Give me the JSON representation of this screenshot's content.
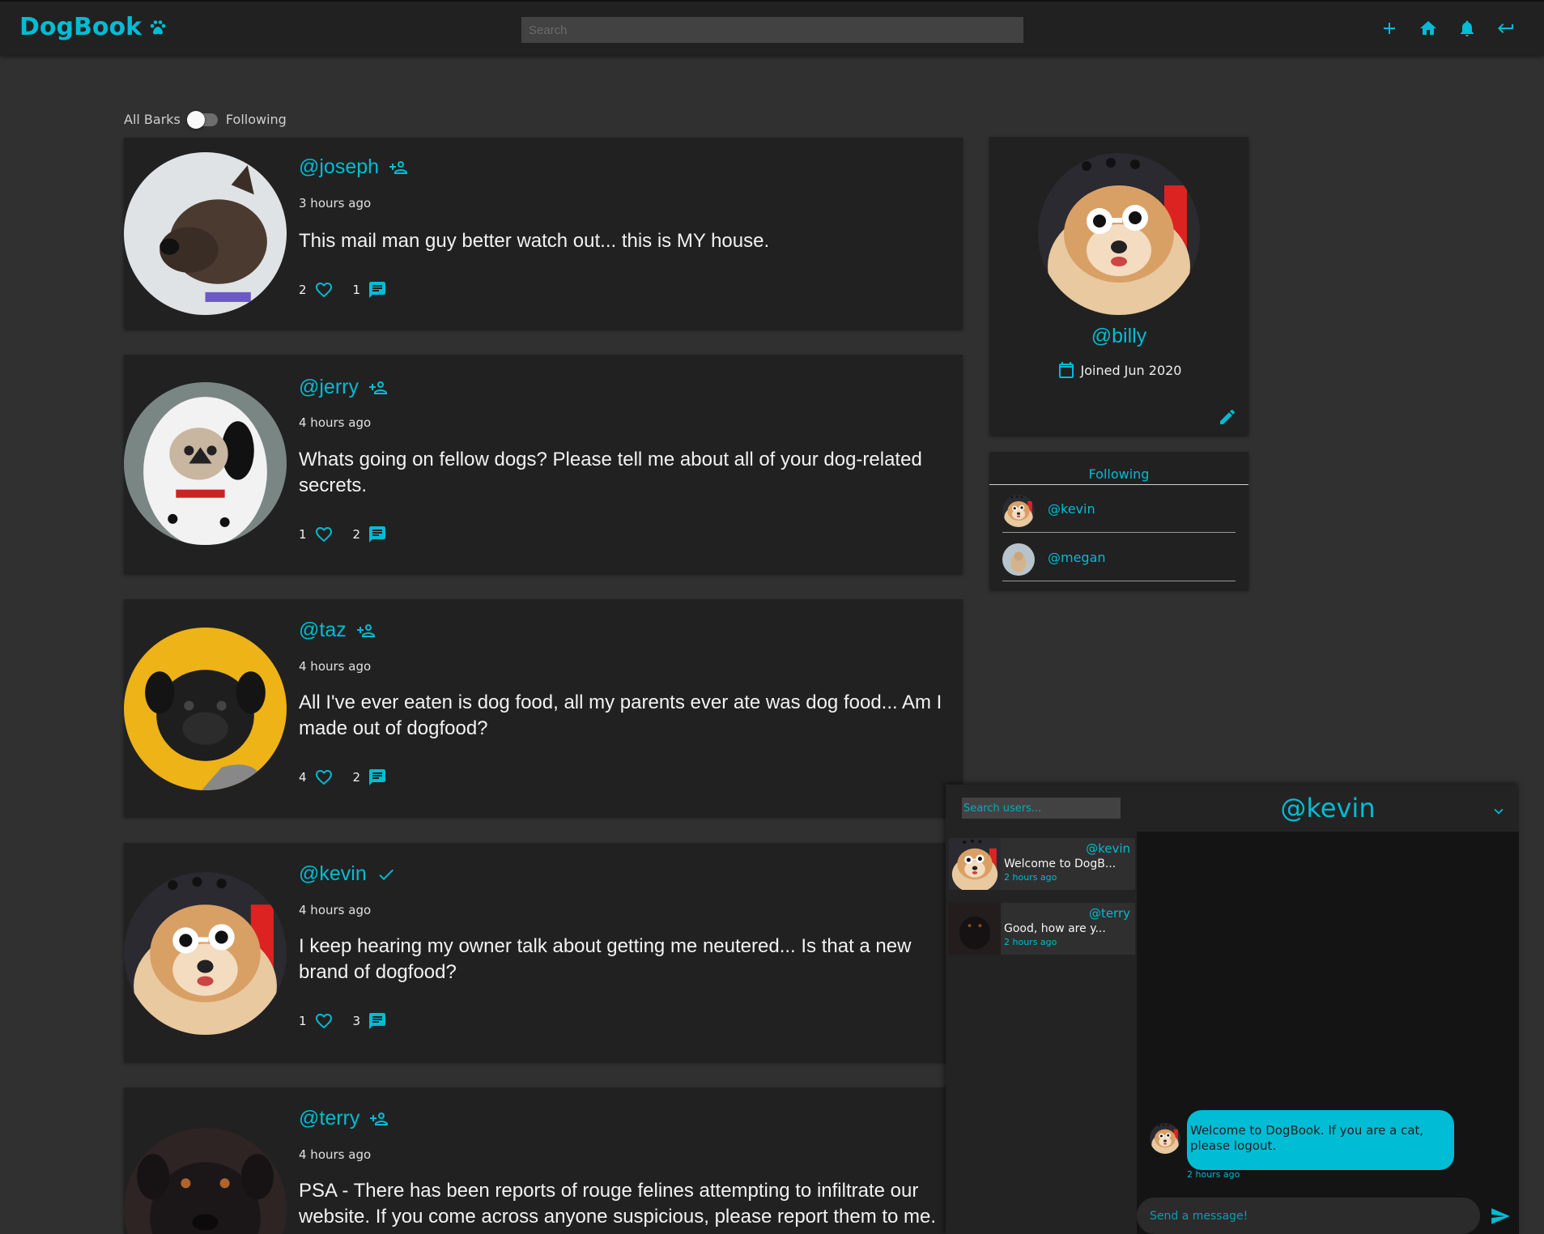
{
  "header": {
    "logo": "DogBook",
    "search_placeholder": "Search",
    "icons": [
      "add-icon",
      "home-icon",
      "bell-icon",
      "logout-icon"
    ]
  },
  "feed_toggle": {
    "left_label": "All Barks",
    "right_label": "Following"
  },
  "posts": [
    {
      "handle": "@joseph",
      "action_icon": "person-add-icon",
      "time": "3 hours ago",
      "text": "This mail man guy better watch out... this is MY house.",
      "likes": "2",
      "comments": "1"
    },
    {
      "handle": "@jerry",
      "action_icon": "person-add-icon",
      "time": "4 hours ago",
      "text": "Whats going on fellow dogs? Please tell me about all of your dog-related secrets.",
      "likes": "1",
      "comments": "2"
    },
    {
      "handle": "@taz",
      "action_icon": "person-add-icon",
      "time": "4 hours ago",
      "text": "All I've ever eaten is dog food, all my parents ever ate was dog food... Am I made out of dogfood?",
      "likes": "4",
      "comments": "2"
    },
    {
      "handle": "@kevin",
      "action_icon": "check-icon",
      "time": "4 hours ago",
      "text": "I keep hearing my owner talk about getting me neutered... Is that a new brand of dogfood?",
      "likes": "1",
      "comments": "3"
    },
    {
      "handle": "@terry",
      "action_icon": "person-add-icon",
      "time": "4 hours ago",
      "text": "PSA - There has been reports of rouge felines attempting to infiltrate our website. If you come across anyone suspicious, please report them to me.",
      "likes": "",
      "comments": ""
    }
  ],
  "profile": {
    "handle": "@billy",
    "joined": "Joined Jun 2020"
  },
  "following": {
    "title": "Following",
    "users": [
      "@kevin",
      "@megan"
    ]
  },
  "messenger": {
    "search_placeholder": "Search users...",
    "conversations": [
      {
        "name": "@kevin",
        "preview": "Welcome to DogB...",
        "time": "2 hours ago"
      },
      {
        "name": "@terry",
        "preview": "Good, how are y...",
        "time": "2 hours ago"
      }
    ],
    "active_chat": "@kevin",
    "message": {
      "text": "Welcome to DogBook. If you are a cat, please logout.",
      "time": "2 hours ago"
    },
    "send_placeholder": "Send a message!"
  },
  "colors": {
    "accent": "#00bcd4",
    "background": "#303030",
    "card": "#212121"
  }
}
